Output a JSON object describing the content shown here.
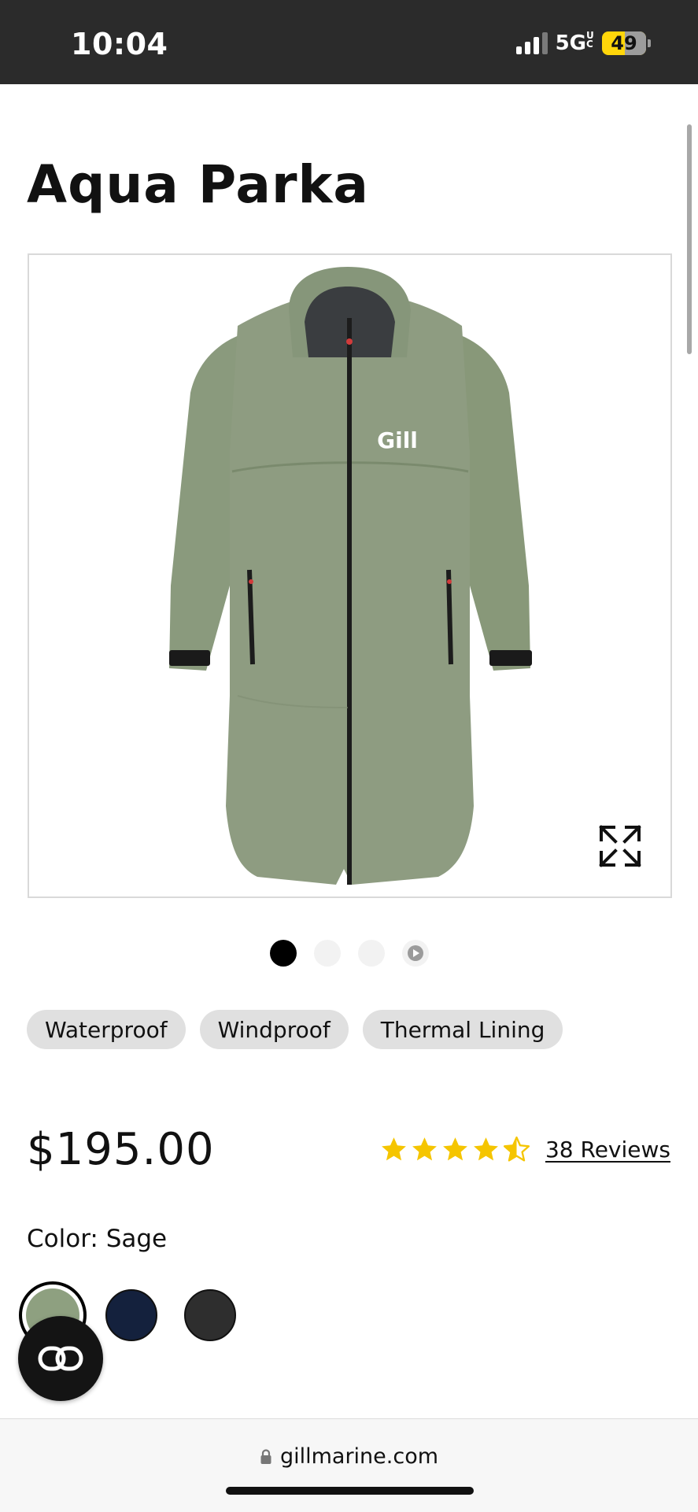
{
  "status_bar": {
    "time": "10:04",
    "network": "5G",
    "network_suffix": "UC",
    "battery": "49"
  },
  "product": {
    "title": "Aqua Parka",
    "price": "$195.00",
    "image_brand_text": "Gill",
    "features": [
      "Waterproof",
      "Windproof",
      "Thermal Lining"
    ],
    "rating_value": 4.5,
    "rating_max": 5,
    "reviews_label": "38 Reviews",
    "color_label": "Color: Sage"
  },
  "carousel": {
    "slides": 4,
    "active_index": 0,
    "last_is_video": true
  },
  "swatches": [
    {
      "name": "Sage",
      "color": "#8ea080",
      "selected": true
    },
    {
      "name": "Navy",
      "color": "#14213d",
      "selected": false
    },
    {
      "name": "Graphite",
      "color": "#2e2e2e",
      "selected": false
    }
  ],
  "icons": {
    "expand": "expand-arrows-icon",
    "compare": "compare-icon",
    "lock": "lock-icon",
    "star": "star-icon",
    "play": "play-icon"
  },
  "colors": {
    "status_bar_bg": "#2b2b2b",
    "battery_accent": "#ffd60a",
    "star": "#f5c500",
    "tag_bg": "#e0e0e0",
    "jacket": "#8e9c81"
  },
  "browser": {
    "url": "gillmarine.com"
  }
}
